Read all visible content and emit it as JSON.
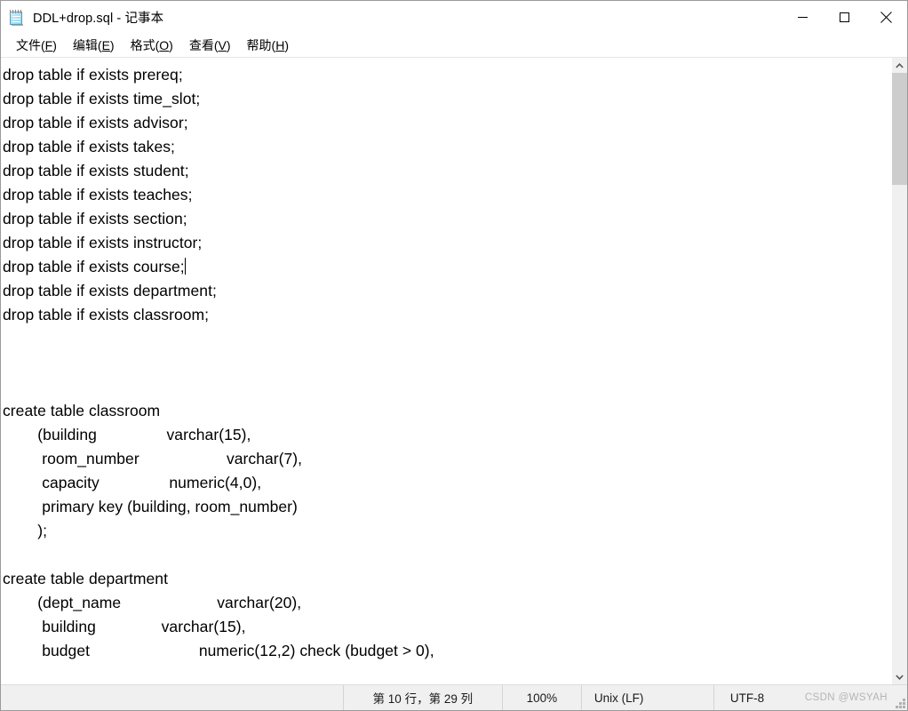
{
  "window": {
    "title": "DDL+drop.sql - 记事本",
    "icon": "notepad-icon",
    "controls": {
      "minimize": "minimize-icon",
      "maximize": "maximize-icon",
      "close": "close-icon"
    }
  },
  "menubar": {
    "items": [
      {
        "label": "文件",
        "accel": "F"
      },
      {
        "label": "编辑",
        "accel": "E"
      },
      {
        "label": "格式",
        "accel": "O"
      },
      {
        "label": "查看",
        "accel": "V"
      },
      {
        "label": "帮助",
        "accel": "H"
      }
    ]
  },
  "editor": {
    "lines": [
      "drop table if exists prereq;",
      "drop table if exists time_slot;",
      "drop table if exists advisor;",
      "drop table if exists takes;",
      "drop table if exists student;",
      "drop table if exists teaches;",
      "drop table if exists section;",
      "drop table if exists instructor;",
      "drop table if exists course;",
      "drop table if exists department;",
      "drop table if exists classroom;",
      "",
      "",
      "",
      "create table classroom",
      "        (building                varchar(15),",
      "         room_number                    varchar(7),",
      "         capacity                numeric(4,0),",
      "         primary key (building, room_number)",
      "        );",
      "",
      "create table department",
      "        (dept_name                      varchar(20),",
      "         building               varchar(15),",
      "         budget                         numeric(12,2) check (budget > 0),"
    ],
    "caret_line_index": 8,
    "caret_symbol": "text-cursor"
  },
  "scrollbar": {
    "up_arrow": "chevron-up-icon",
    "down_arrow": "chevron-down-icon",
    "thumb": "scroll-thumb"
  },
  "statusbar": {
    "position": "第 10 行，第 29 列",
    "zoom": "100%",
    "line_ending": "Unix (LF)",
    "encoding": "UTF-8",
    "watermark": "CSDN @WSYAH"
  },
  "colors": {
    "window_bg": "#ffffff",
    "statusbar_bg": "#f0f0f0",
    "scroll_thumb": "#cdcdcd",
    "text": "#000000",
    "watermark": "#b5b5b5"
  }
}
